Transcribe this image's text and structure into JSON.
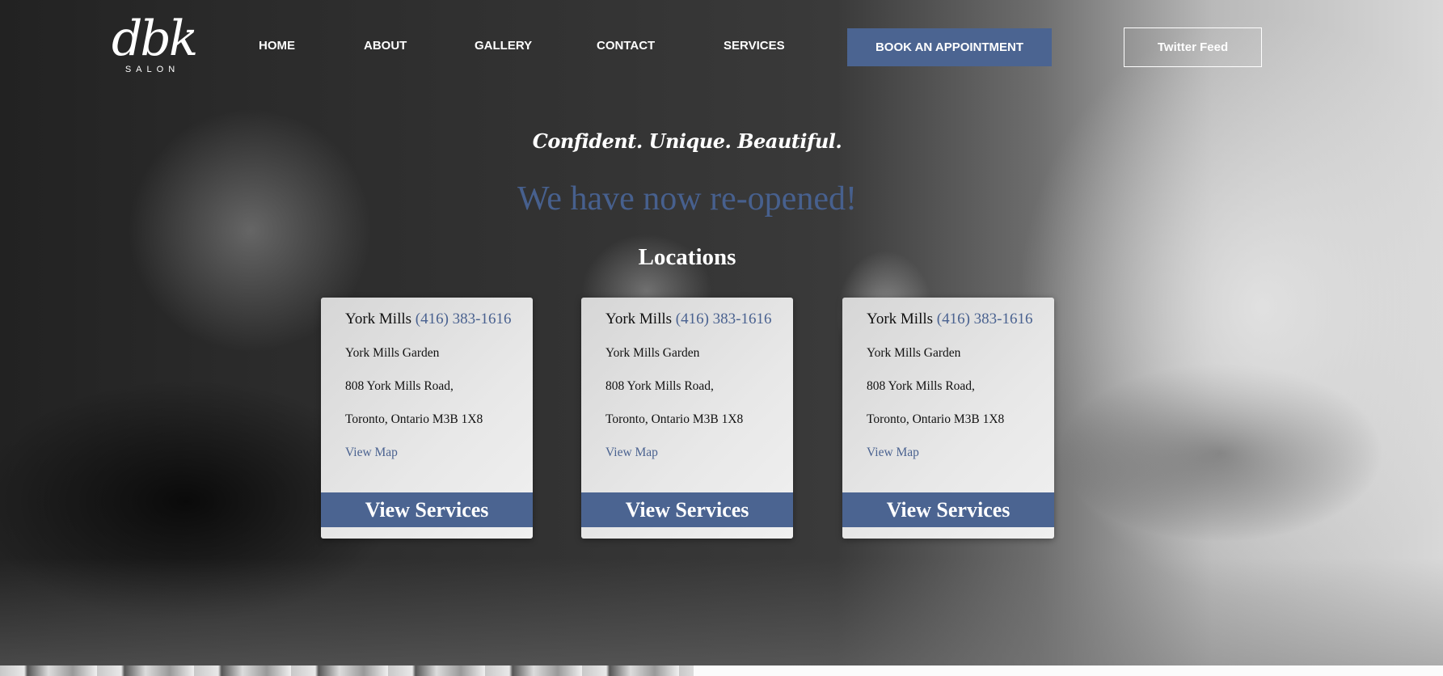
{
  "brand": {
    "logo_mark": "dbk",
    "logo_sub": "SALON"
  },
  "nav": [
    {
      "label": "HOME"
    },
    {
      "label": "ABOUT"
    },
    {
      "label": "GALLERY"
    },
    {
      "label": "CONTACT"
    },
    {
      "label": "SERVICES"
    }
  ],
  "header": {
    "book_label": "BOOK AN APPOINTMENT",
    "twitter_label": "Twitter Feed"
  },
  "hero": {
    "tagline": "Confident. Unique. Beautiful.",
    "headline": "We have now re-opened!",
    "locations_title": "Locations"
  },
  "locations": [
    {
      "name": "York Mills",
      "phone": "(416) 383-1616",
      "line1": "York Mills Garden",
      "line2": "808 York Mills Road,",
      "line3": "Toronto, Ontario M3B 1X8",
      "map_label": "View Map",
      "cta_label": "View Services"
    },
    {
      "name": "York Mills",
      "phone": "(416) 383-1616",
      "line1": "York Mills Garden",
      "line2": "808 York Mills Road,",
      "line3": "Toronto, Ontario M3B 1X8",
      "map_label": "View Map",
      "cta_label": "View Services"
    },
    {
      "name": "York Mills",
      "phone": "(416) 383-1616",
      "line1": "York Mills Garden",
      "line2": "808 York Mills Road,",
      "line3": "Toronto, Ontario M3B 1X8",
      "map_label": "View Map",
      "cta_label": "View Services"
    }
  ],
  "colors": {
    "accent": "#4b6491",
    "headline": "#47608e",
    "text_light": "#ffffff"
  }
}
